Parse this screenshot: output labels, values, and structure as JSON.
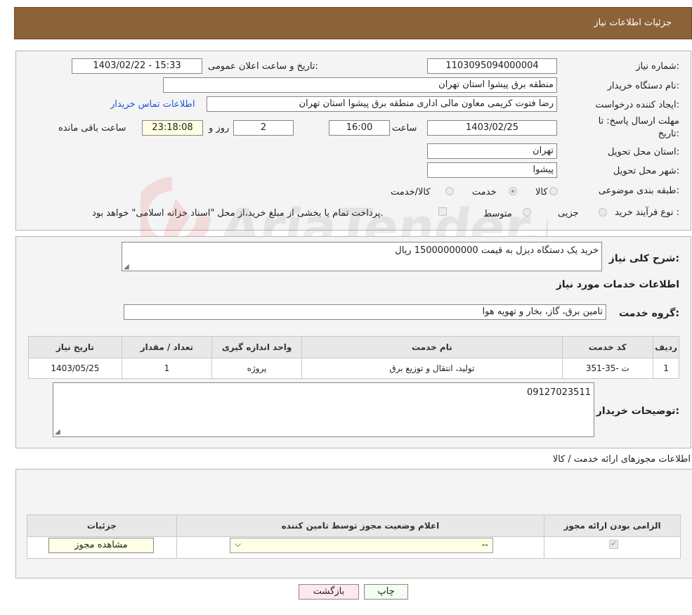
{
  "header": {
    "title": "جزئیات اطلاعات نیاز"
  },
  "form": {
    "need_number_label": "شماره نیاز:",
    "need_number": "1103095094000004",
    "announce_label": "تاریخ و ساعت اعلان عمومی:",
    "announce_value": "1403/02/22 - 15:33",
    "buyer_org_label": "نام دستگاه خریدار:",
    "buyer_org": "منطقه برق پیشوا استان تهران",
    "requester_label": "ایجاد کننده درخواست:",
    "requester": "رضا فتوت کریمی معاون مالی اداری منطقه برق پیشوا استان تهران",
    "contact_link": "اطلاعات تماس خریدار",
    "deadline_label_1": "مهلت ارسال پاسخ: تا",
    "deadline_label_2": "تاریخ:",
    "deadline_date": "1403/02/25",
    "time_label": "ساعت",
    "deadline_time": "16:00",
    "days": "2",
    "days_label": "روز و",
    "remaining": "23:18:08",
    "remaining_label": "ساعت باقی مانده",
    "province_label": "استان محل تحویل:",
    "province": "تهران",
    "city_label": "شهر محل تحویل:",
    "city": "پیشوا",
    "category_label": "طبقه بندی موضوعی:",
    "category_options": [
      "کالا",
      "خدمت",
      "کالا/خدمت"
    ],
    "category_selected": "خدمت",
    "process_label": "نوع فرآیند خرید :",
    "process_options": [
      "جزیی",
      "متوسط"
    ],
    "payment_note": "پرداخت تمام یا بخشی از مبلغ خرید،از محل \"اسناد خزانه اسلامی\" خواهد بود."
  },
  "summary": {
    "label": "شرح کلی نیاز:",
    "value": "خرید یک دستگاه دیزل به قیمت 15000000000 ریال"
  },
  "services": {
    "section_title": "اطلاعات خدمات مورد نیاز",
    "group_label": "گروه خدمت:",
    "group_value": "تامین برق، گاز، بخار و تهویه هوا",
    "columns": [
      "ردیف",
      "کد خدمت",
      "نام خدمت",
      "واحد اندازه گیری",
      "تعداد / مقدار",
      "تاریخ نیاز"
    ],
    "rows": [
      [
        "1",
        "ت -35-351",
        "تولید، انتقال و توزیع برق",
        "پروژه",
        "1",
        "1403/05/25"
      ]
    ]
  },
  "buyer_notes": {
    "label": "توضیحات خریدار:",
    "value": "09127023511"
  },
  "permits": {
    "section_title": "اطلاعات مجوزهای ارائه خدمت / کالا",
    "columns": [
      "الزامی بودن ارائه مجوز",
      "اعلام وضعیت مجوز توسط تامین کننده",
      "جزئیات"
    ],
    "select_value": "--",
    "view_button": "مشاهده مجوز"
  },
  "footer": {
    "print_button": "چاپ",
    "back_button": "بازگشت"
  },
  "watermark_text": "AriaTender.neT"
}
